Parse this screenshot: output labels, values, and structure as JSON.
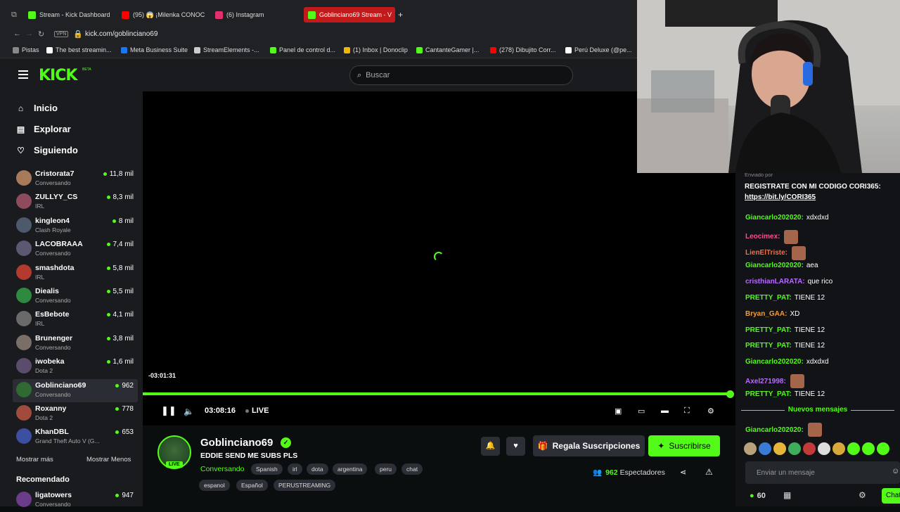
{
  "browser": {
    "tabs": [
      {
        "label": "Stream - Kick Dashboard",
        "color": "#53fc18"
      },
      {
        "label": "(95) 😱 ¡Milenka CONOC",
        "color": "#ff0000"
      },
      {
        "label": "(6) Instagram",
        "color": "#e1306c"
      },
      {
        "label": "Goblinciano69 Stream - V",
        "color": "#53fc18"
      }
    ],
    "new_tab": "+",
    "vpn": "VPN",
    "url": "kick.com/goblinciano69",
    "bookmarks": [
      {
        "label": "Pistas",
        "color": "#888888"
      },
      {
        "label": "The best streamin...",
        "color": "#ffffff"
      },
      {
        "label": "Meta Business Suite",
        "color": "#1877f2"
      },
      {
        "label": "StreamElements -...",
        "color": "#cccccc"
      },
      {
        "label": "Panel de control d...",
        "color": "#53fc18"
      },
      {
        "label": "(1) Inbox | Donoclip",
        "color": "#f5b400"
      },
      {
        "label": "CantanteGamer |...",
        "color": "#53fc18"
      },
      {
        "label": "(278) Dibujito Corr...",
        "color": "#ff0000"
      },
      {
        "label": "Perú Deluxe (@pe...",
        "color": "#ffffff"
      }
    ]
  },
  "header": {
    "logo": "KICK",
    "logo_badge": "BETA",
    "search_placeholder": "Buscar"
  },
  "sidebar": {
    "nav": [
      {
        "label": "Inicio",
        "icon": "home-icon"
      },
      {
        "label": "Explorar",
        "icon": "compass-icon"
      },
      {
        "label": "Siguiendo",
        "icon": "heart-icon"
      }
    ],
    "channels": [
      {
        "name": "Cristorata7",
        "game": "Conversando",
        "viewers": "11,8 mil",
        "color": "#a77a5a"
      },
      {
        "name": "ZULLYY_CS",
        "game": "IRL",
        "viewers": "8,3 mil",
        "color": "#8e4b5e"
      },
      {
        "name": "kingleon4",
        "game": "Clash Royale",
        "viewers": "8 mil",
        "color": "#4c5a6b"
      },
      {
        "name": "LACOBRAAA",
        "game": "Conversando",
        "viewers": "7,4 mil",
        "color": "#5d5872"
      },
      {
        "name": "smashdota",
        "game": "IRL",
        "viewers": "5,8 mil",
        "color": "#b23a2e"
      },
      {
        "name": "Diealis",
        "game": "Conversando",
        "viewers": "5,5 mil",
        "color": "#2e8a3e"
      },
      {
        "name": "EsBebote",
        "game": "IRL",
        "viewers": "4,1 mil",
        "color": "#6a6a6a"
      },
      {
        "name": "Brunenger",
        "game": "Conversando",
        "viewers": "3,8 mil",
        "color": "#7a6f66"
      },
      {
        "name": "iwobeka",
        "game": "Dota 2",
        "viewers": "1,6 mil",
        "color": "#5b4c6e"
      },
      {
        "name": "Goblinciano69",
        "game": "Conversando",
        "viewers": "962",
        "color": "#2f6a33"
      },
      {
        "name": "Roxanny",
        "game": "Dota 2",
        "viewers": "778",
        "color": "#a04b3c"
      },
      {
        "name": "KhanDBL",
        "game": "Grand Theft Auto V (G...",
        "viewers": "653",
        "color": "#3c4fa0"
      }
    ],
    "show_more": "Mostrar más",
    "show_less": "Mostrar Menos",
    "recommended_title": "Recomendado",
    "recommended": [
      {
        "name": "ligatowers",
        "game": "Conversando",
        "viewers": "947",
        "color": "#6a3c8a"
      }
    ]
  },
  "player": {
    "seek_time": "-03:01:31",
    "elapsed": "03:08:16",
    "live": "LIVE",
    "progress": 1.0
  },
  "stream": {
    "name": "Goblinciano69",
    "live_badge": "LIVE",
    "title": "EDDIE SEND ME SUBS PLS",
    "category": "Conversando",
    "tags": [
      "Spanish",
      "irl",
      "dota",
      "argentina",
      "peru",
      "chat",
      "espanol",
      "Español",
      "PERUSTREAMING"
    ],
    "gift_label": "Regala Suscripciones",
    "subscribe_label": "Suscribirse",
    "viewers_count": "962",
    "viewers_label": "Espectadores"
  },
  "chat": {
    "pinned_by": "Enviado por",
    "pinned_text": "REGISTRATE CON MI CODIGO CORI365:",
    "pinned_link": "https://bit.ly/CORI365",
    "messages": [
      {
        "user": "Giancarlo202020:",
        "text": "xdxdxd",
        "color": "#53fc18",
        "emote": false
      },
      {
        "user": "Leocimex:",
        "text": "",
        "color": "#ff4d8d",
        "emote": true
      },
      {
        "user": "LienElTriste:",
        "text": "",
        "color": "#ff6a3d",
        "emote": true
      },
      {
        "user": "Giancarlo202020:",
        "text": "aea",
        "color": "#53fc18",
        "emote": false
      },
      {
        "user": "cristhianLARATA:",
        "text": "que rico",
        "color": "#b76bff",
        "emote": false
      },
      {
        "user": "PRETTY_PAT:",
        "text": "TIENE 12",
        "color": "#53fc18",
        "emote": false
      },
      {
        "user": "Bryan_GAA:",
        "text": "XD",
        "color": "#f29b38",
        "emote": false
      },
      {
        "user": "PRETTY_PAT:",
        "text": "TIENE 12",
        "color": "#53fc18",
        "emote": false
      },
      {
        "user": "PRETTY_PAT:",
        "text": "TIENE 12",
        "color": "#53fc18",
        "emote": false
      },
      {
        "user": "Giancarlo202020:",
        "text": "xdxdxd",
        "color": "#53fc18",
        "emote": false
      },
      {
        "user": "Axel271998:",
        "text": "",
        "color": "#b76bff",
        "emote": true
      },
      {
        "user": "PRETTY_PAT:",
        "text": "TIENE 12",
        "color": "#53fc18",
        "emote": false
      }
    ],
    "new_messages": "Nuevos mensajes",
    "after_new": {
      "user": "Giancarlo202020:",
      "color": "#53fc18"
    },
    "input_placeholder": "Enviar un mensaje",
    "points": "60",
    "send_label": "Chat"
  },
  "colors": {
    "accent": "#53fc18",
    "background": "#0b0e0f",
    "panel": "#191b1f"
  }
}
